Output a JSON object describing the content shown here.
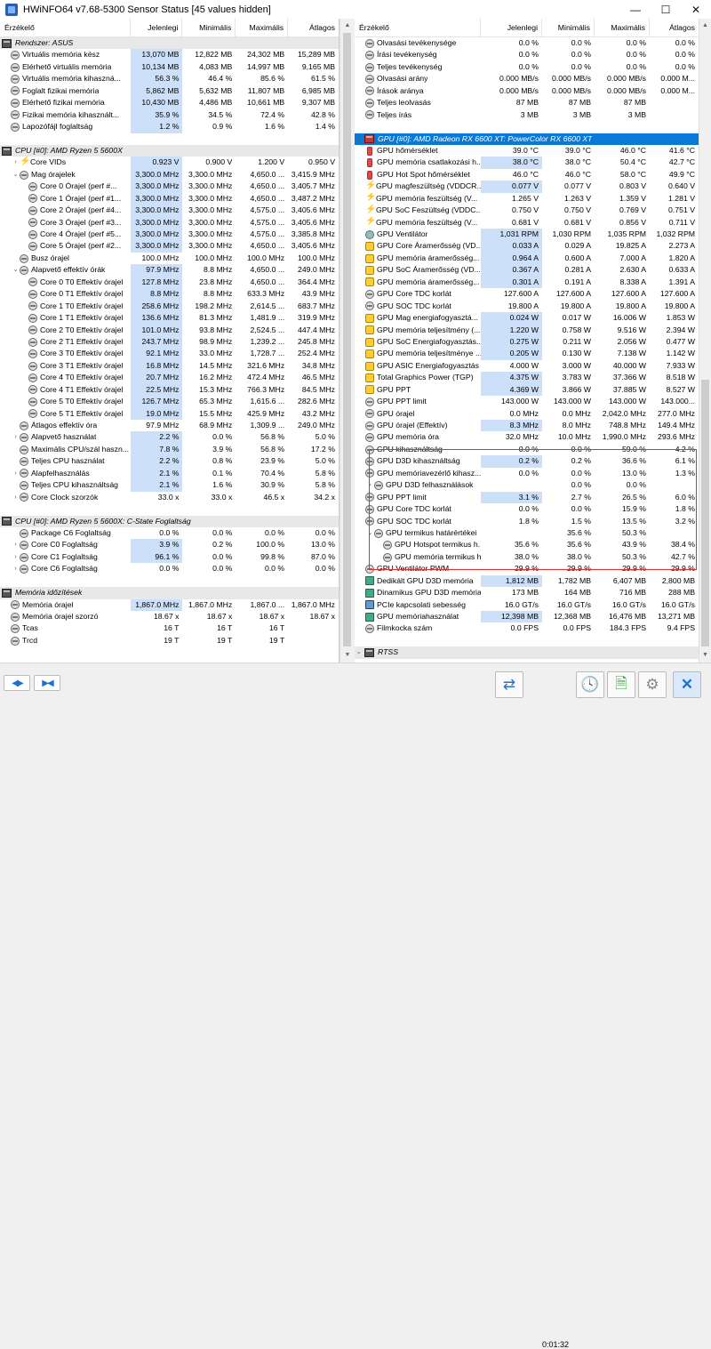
{
  "window": {
    "title": "HWiNFO64 v7.68-5300 Sensor Status [45 values hidden]",
    "minimize": "—",
    "maximize": "☐",
    "close": "✕"
  },
  "columns": {
    "name": "Érzékelő",
    "current": "Jelenlegi",
    "min": "Minimális",
    "max": "Maximális",
    "avg": "Átlagos"
  },
  "left_rows": [
    {
      "t": "group",
      "icon": "pc",
      "name": "Rendszer: ASUS"
    },
    {
      "icon": "gauge",
      "name": "Virtuális memória kész",
      "cur": "13,070 MB",
      "min": "12,822 MB",
      "max": "24,302 MB",
      "avg": "15,289 MB",
      "hl": true
    },
    {
      "icon": "gauge",
      "name": "Elérhető virtuális memória",
      "cur": "10,134 MB",
      "min": "4,083 MB",
      "max": "14,997 MB",
      "avg": "9,165 MB",
      "hl": true
    },
    {
      "icon": "gauge",
      "name": "Virtuális memória kihaszná...",
      "cur": "56.3 %",
      "min": "46.4 %",
      "max": "85.6 %",
      "avg": "61.5 %",
      "hl": true
    },
    {
      "icon": "gauge",
      "name": "Foglalt fizikai memória",
      "cur": "5,862 MB",
      "min": "5,632 MB",
      "max": "11,807 MB",
      "avg": "6,985 MB",
      "hl": true
    },
    {
      "icon": "gauge",
      "name": "Elérhető fizikai memória",
      "cur": "10,430 MB",
      "min": "4,486 MB",
      "max": "10,661 MB",
      "avg": "9,307 MB",
      "hl": true
    },
    {
      "icon": "gauge",
      "name": "Fizikai memória kihasznált...",
      "cur": "35.9 %",
      "min": "34.5 %",
      "max": "72.4 %",
      "avg": "42.8 %",
      "hl": true
    },
    {
      "icon": "gauge",
      "name": "Lapozófájl foglaltság",
      "cur": "1.2 %",
      "min": "0.9 %",
      "max": "1.6 %",
      "avg": "1.4 %",
      "hl": true
    },
    {
      "t": "blank"
    },
    {
      "t": "group",
      "icon": "chip",
      "name": "CPU [#0]: AMD Ryzen 5 5600X"
    },
    {
      "tg": ">",
      "icon": "volt",
      "ind": 1,
      "name": "Core VIDs",
      "cur": "0.923 V",
      "min": "0.900 V",
      "max": "1.200 V",
      "avg": "0.950 V",
      "hl": true
    },
    {
      "tg": "v",
      "icon": "gauge",
      "ind": 1,
      "name": "Mag órajelek",
      "cur": "3,300.0 MHz",
      "min": "3,300.0 MHz",
      "max": "4,650.0 ...",
      "avg": "3,415.9 MHz",
      "hl": true
    },
    {
      "icon": "gauge",
      "ind": 2,
      "name": "Core 0 Órajel (perf #...",
      "cur": "3,300.0 MHz",
      "min": "3,300.0 MHz",
      "max": "4,650.0 ...",
      "avg": "3,405.7 MHz",
      "hl": true
    },
    {
      "icon": "gauge",
      "ind": 2,
      "name": "Core 1 Órajel (perf #1...",
      "cur": "3,300.0 MHz",
      "min": "3,300.0 MHz",
      "max": "4,650.0 ...",
      "avg": "3,487.2 MHz",
      "hl": true
    },
    {
      "icon": "gauge",
      "ind": 2,
      "name": "Core 2 Órajel (perf #4...",
      "cur": "3,300.0 MHz",
      "min": "3,300.0 MHz",
      "max": "4,575.0 ...",
      "avg": "3,405.6 MHz",
      "hl": true
    },
    {
      "icon": "gauge",
      "ind": 2,
      "name": "Core 3 Órajel (perf #3...",
      "cur": "3,300.0 MHz",
      "min": "3,300.0 MHz",
      "max": "4,575.0 ...",
      "avg": "3,405.6 MHz",
      "hl": true
    },
    {
      "icon": "gauge",
      "ind": 2,
      "name": "Core 4 Órajel (perf #5...",
      "cur": "3,300.0 MHz",
      "min": "3,300.0 MHz",
      "max": "4,575.0 ...",
      "avg": "3,385.8 MHz",
      "hl": true
    },
    {
      "icon": "gauge",
      "ind": 2,
      "name": "Core 5 Órajel (perf #2...",
      "cur": "3,300.0 MHz",
      "min": "3,300.0 MHz",
      "max": "4,650.0 ...",
      "avg": "3,405.6 MHz",
      "hl": true
    },
    {
      "icon": "gauge",
      "ind": 1,
      "name": "Busz órajel",
      "cur": "100.0 MHz",
      "min": "100.0 MHz",
      "max": "100.0 MHz",
      "avg": "100.0 MHz",
      "hl": false
    },
    {
      "tg": "v",
      "icon": "gauge",
      "ind": 1,
      "name": "Alapvető effektív órák",
      "cur": "97.9 MHz",
      "min": "8.8 MHz",
      "max": "4,650.0 ...",
      "avg": "249.0 MHz",
      "hl": true
    },
    {
      "icon": "gauge",
      "ind": 2,
      "name": "Core 0 T0 Effektív órajel",
      "cur": "127.8 MHz",
      "min": "23.8 MHz",
      "max": "4,650.0 ...",
      "avg": "364.4 MHz",
      "hl": true
    },
    {
      "icon": "gauge",
      "ind": 2,
      "name": "Core 0 T1 Effektív órajel",
      "cur": "8.8 MHz",
      "min": "8.8 MHz",
      "max": "633.3 MHz",
      "avg": "43.9 MHz",
      "hl": true
    },
    {
      "icon": "gauge",
      "ind": 2,
      "name": "Core 1 T0 Effektív órajel",
      "cur": "258.6 MHz",
      "min": "198.2 MHz",
      "max": "2,614.5 ...",
      "avg": "683.7 MHz",
      "hl": true
    },
    {
      "icon": "gauge",
      "ind": 2,
      "name": "Core 1 T1 Effektív órajel",
      "cur": "136.6 MHz",
      "min": "81.3 MHz",
      "max": "1,481.9 ...",
      "avg": "319.9 MHz",
      "hl": true
    },
    {
      "icon": "gauge",
      "ind": 2,
      "name": "Core 2 T0 Effektív órajel",
      "cur": "101.0 MHz",
      "min": "93.8 MHz",
      "max": "2,524.5 ...",
      "avg": "447.4 MHz",
      "hl": true
    },
    {
      "icon": "gauge",
      "ind": 2,
      "name": "Core 2 T1 Effektív órajel",
      "cur": "243.7 MHz",
      "min": "98.9 MHz",
      "max": "1,239.2 ...",
      "avg": "245.8 MHz",
      "hl": true
    },
    {
      "icon": "gauge",
      "ind": 2,
      "name": "Core 3 T0 Effektív órajel",
      "cur": "92.1 MHz",
      "min": "33.0 MHz",
      "max": "1,728.7 ...",
      "avg": "252.4 MHz",
      "hl": true
    },
    {
      "icon": "gauge",
      "ind": 2,
      "name": "Core 3 T1 Effektív órajel",
      "cur": "16.8 MHz",
      "min": "14.5 MHz",
      "max": "321.6 MHz",
      "avg": "34.8 MHz",
      "hl": true
    },
    {
      "icon": "gauge",
      "ind": 2,
      "name": "Core 4 T0 Effektív órajel",
      "cur": "20.7 MHz",
      "min": "16.2 MHz",
      "max": "472.4 MHz",
      "avg": "46.5 MHz",
      "hl": true
    },
    {
      "icon": "gauge",
      "ind": 2,
      "name": "Core 4 T1 Effektív órajel",
      "cur": "22.5 MHz",
      "min": "15.3 MHz",
      "max": "766.3 MHz",
      "avg": "84.5 MHz",
      "hl": true
    },
    {
      "icon": "gauge",
      "ind": 2,
      "name": "Core 5 T0 Effektív órajel",
      "cur": "126.7 MHz",
      "min": "65.3 MHz",
      "max": "1,615.6 ...",
      "avg": "282.6 MHz",
      "hl": true
    },
    {
      "icon": "gauge",
      "ind": 2,
      "name": "Core 5 T1 Effektív órajel",
      "cur": "19.0 MHz",
      "min": "15.5 MHz",
      "max": "425.9 MHz",
      "avg": "43.2 MHz",
      "hl": true
    },
    {
      "icon": "gauge",
      "ind": 1,
      "name": "Átlagos effektív óra",
      "cur": "97.9 MHz",
      "min": "68.9 MHz",
      "max": "1,309.9 ...",
      "avg": "249.0 MHz",
      "hl": false
    },
    {
      "tg": ">",
      "icon": "gauge",
      "ind": 1,
      "name": "Alapvető használat",
      "cur": "2.2 %",
      "min": "0.0 %",
      "max": "56.8 %",
      "avg": "5.0 %",
      "hl": true
    },
    {
      "icon": "gauge",
      "ind": 1,
      "name": "Maximális CPU/szál haszn...",
      "cur": "7.8 %",
      "min": "3.9 %",
      "max": "56.8 %",
      "avg": "17.2 %",
      "hl": true
    },
    {
      "icon": "gauge",
      "ind": 1,
      "name": "Teljes CPU használat",
      "cur": "2.2 %",
      "min": "0.8 %",
      "max": "23.9 %",
      "avg": "5.0 %",
      "hl": true
    },
    {
      "tg": ">",
      "icon": "gauge",
      "ind": 1,
      "name": "Alapfelhasználás",
      "cur": "2.1 %",
      "min": "0.1 %",
      "max": "70.4 %",
      "avg": "5.8 %",
      "hl": true
    },
    {
      "icon": "gauge",
      "ind": 1,
      "name": "Teljes CPU kihasználtság",
      "cur": "2.1 %",
      "min": "1.6 %",
      "max": "30.9 %",
      "avg": "5.8 %",
      "hl": true
    },
    {
      "tg": ">",
      "icon": "gauge",
      "ind": 1,
      "name": "Core Clock szorzók",
      "cur": "33.0 x",
      "min": "33.0 x",
      "max": "46.5 x",
      "avg": "34.2 x",
      "hl": false
    },
    {
      "t": "blank"
    },
    {
      "t": "group",
      "icon": "chip",
      "name": "CPU [#0]: AMD Ryzen 5 5600X: C-State Foglaltság"
    },
    {
      "icon": "gauge",
      "ind": 1,
      "name": "Package C6 Foglaltság",
      "cur": "0.0 %",
      "min": "0.0 %",
      "max": "0.0 %",
      "avg": "0.0 %",
      "hl": false
    },
    {
      "tg": ">",
      "icon": "gauge",
      "ind": 1,
      "name": "Core C0 Foglaltság",
      "cur": "3.9 %",
      "min": "0.2 %",
      "max": "100.0 %",
      "avg": "13.0 %",
      "hl": true
    },
    {
      "tg": ">",
      "icon": "gauge",
      "ind": 1,
      "name": "Core C1 Foglaltság",
      "cur": "96.1 %",
      "min": "0.0 %",
      "max": "99.8 %",
      "avg": "87.0 %",
      "hl": true
    },
    {
      "tg": ">",
      "icon": "gauge",
      "ind": 1,
      "name": "Core C6 Foglaltság",
      "cur": "0.0 %",
      "min": "0.0 %",
      "max": "0.0 %",
      "avg": "0.0 %",
      "hl": false
    },
    {
      "t": "blank"
    },
    {
      "t": "group",
      "icon": "mem",
      "name": "Memória időzítések"
    },
    {
      "icon": "gauge",
      "name": "Memória órajel",
      "cur": "1,867.0 MHz",
      "min": "1,867.0 MHz",
      "max": "1,867.0 ...",
      "avg": "1,867.0 MHz",
      "hl": true
    },
    {
      "icon": "gauge",
      "name": "Memória órajel szorzó",
      "cur": "18.67 x",
      "min": "18.67 x",
      "max": "18.67 x",
      "avg": "18.67 x",
      "hl": false
    },
    {
      "icon": "gauge",
      "name": "Tcas",
      "cur": "16 T",
      "min": "16 T",
      "max": "16 T",
      "avg": "",
      "hl": false
    },
    {
      "icon": "gauge",
      "name": "Trcd",
      "cur": "19 T",
      "min": "19 T",
      "max": "19 T",
      "avg": "",
      "hl": false
    }
  ],
  "right_rows": [
    {
      "icon": "gauge",
      "name": "Olvasási tevékenysége",
      "cur": "0.0 %",
      "min": "0.0 %",
      "max": "0.0 %",
      "avg": "0.0 %"
    },
    {
      "icon": "gauge",
      "name": "Írási tevékenység",
      "cur": "0.0 %",
      "min": "0.0 %",
      "max": "0.0 %",
      "avg": "0.0 %"
    },
    {
      "icon": "gauge",
      "name": "Teljes tevékenység",
      "cur": "0.0 %",
      "min": "0.0 %",
      "max": "0.0 %",
      "avg": "0.0 %"
    },
    {
      "icon": "gauge",
      "name": "Olvasási arány",
      "cur": "0.000 MB/s",
      "min": "0.000 MB/s",
      "max": "0.000 MB/s",
      "avg": "0.000 M..."
    },
    {
      "icon": "gauge",
      "name": "Írások aránya",
      "cur": "0.000 MB/s",
      "min": "0.000 MB/s",
      "max": "0.000 MB/s",
      "avg": "0.000 M..."
    },
    {
      "icon": "gauge",
      "name": "Teljes leolvasás",
      "cur": "87 MB",
      "min": "87 MB",
      "max": "87 MB",
      "avg": ""
    },
    {
      "icon": "gauge",
      "name": "Teljes írás",
      "cur": "3 MB",
      "min": "3 MB",
      "max": "3 MB",
      "avg": ""
    },
    {
      "t": "blank"
    },
    {
      "t": "group",
      "sel": true,
      "tg": "v",
      "icon": "gpu",
      "name": "GPU [#0]: AMD Radeon RX 6600 XT: PowerColor RX 6600 XT"
    },
    {
      "icon": "temp",
      "name": "GPU hőmérséklet",
      "cur": "39.0 °C",
      "min": "39.0 °C",
      "max": "46.0 °C",
      "avg": "41.6 °C"
    },
    {
      "icon": "temp",
      "name": "GPU memória csatlakozási h...",
      "cur": "38.0 °C",
      "min": "38.0 °C",
      "max": "50.4 °C",
      "avg": "42.7 °C",
      "hl": true
    },
    {
      "icon": "temp",
      "name": "GPU Hot Spot hőmérséklet",
      "cur": "46.0 °C",
      "min": "46.0 °C",
      "max": "58.0 °C",
      "avg": "49.9 °C"
    },
    {
      "icon": "volt",
      "name": "GPU magfeszültség (VDDCR...",
      "cur": "0.077 V",
      "min": "0.077 V",
      "max": "0.803 V",
      "avg": "0.640 V",
      "hl": true
    },
    {
      "icon": "volt",
      "name": "GPU memória feszültség (V...",
      "cur": "1.265 V",
      "min": "1.263 V",
      "max": "1.359 V",
      "avg": "1.281 V"
    },
    {
      "icon": "volt",
      "name": "GPU SoC Feszültség (VDDC...",
      "cur": "0.750 V",
      "min": "0.750 V",
      "max": "0.769 V",
      "avg": "0.751 V"
    },
    {
      "icon": "volt",
      "name": "GPU memória feszültség (V...",
      "cur": "0.681 V",
      "min": "0.681 V",
      "max": "0.856 V",
      "avg": "0.711 V"
    },
    {
      "icon": "fan",
      "name": "GPU Ventilátor",
      "cur": "1,031 RPM",
      "min": "1,030 RPM",
      "max": "1,035 RPM",
      "avg": "1,032 RPM",
      "hl": true
    },
    {
      "icon": "pow",
      "name": "GPU Core Áramerősség (VD...",
      "cur": "0.033 A",
      "min": "0.029 A",
      "max": "19.825 A",
      "avg": "2.273 A",
      "hl": true
    },
    {
      "icon": "pow",
      "name": "GPU memória áramerősség...",
      "cur": "0.964 A",
      "min": "0.600 A",
      "max": "7.000 A",
      "avg": "1.820 A",
      "hl": true
    },
    {
      "icon": "pow",
      "name": "GPU SoC Áramerősség (VD...",
      "cur": "0.367 A",
      "min": "0.281 A",
      "max": "2.630 A",
      "avg": "0.633 A",
      "hl": true
    },
    {
      "icon": "pow",
      "name": "GPU memória áramerősség...",
      "cur": "0.301 A",
      "min": "0.191 A",
      "max": "8.338 A",
      "avg": "1.391 A",
      "hl": true
    },
    {
      "icon": "gauge",
      "name": "GPU Core TDC korlát",
      "cur": "127.600 A",
      "min": "127.600 A",
      "max": "127.600 A",
      "avg": "127.600 A"
    },
    {
      "icon": "gauge",
      "name": "GPU SOC TDC korlát",
      "cur": "19.800 A",
      "min": "19.800 A",
      "max": "19.800 A",
      "avg": "19.800 A"
    },
    {
      "icon": "pow",
      "name": "GPU Mag energiafogyasztá...",
      "cur": "0.024 W",
      "min": "0.017 W",
      "max": "16.006 W",
      "avg": "1.853 W",
      "hl": true
    },
    {
      "icon": "pow",
      "name": "GPU memória teljesítmény (...",
      "cur": "1.220 W",
      "min": "0.758 W",
      "max": "9.516 W",
      "avg": "2.394 W",
      "hl": true
    },
    {
      "icon": "pow",
      "name": "GPU SoC Energiafogyasztás...",
      "cur": "0.275 W",
      "min": "0.211 W",
      "max": "2.056 W",
      "avg": "0.477 W",
      "hl": true
    },
    {
      "icon": "pow",
      "name": "GPU memória teljesítménye ...",
      "cur": "0.205 W",
      "min": "0.130 W",
      "max": "7.138 W",
      "avg": "1.142 W",
      "hl": true
    },
    {
      "icon": "pow",
      "name": "GPU ASIC Energiafogyasztás",
      "cur": "4.000 W",
      "min": "3.000 W",
      "max": "40.000 W",
      "avg": "7.933 W"
    },
    {
      "icon": "pow",
      "name": "Total Graphics Power (TGP)",
      "cur": "4.375 W",
      "min": "3.783 W",
      "max": "37.366 W",
      "avg": "8.518 W",
      "hl": true
    },
    {
      "icon": "pow",
      "name": "GPU PPT",
      "cur": "4.369 W",
      "min": "3.866 W",
      "max": "37.885 W",
      "avg": "8.527 W",
      "hl": true
    },
    {
      "icon": "gauge",
      "name": "GPU PPT limit",
      "cur": "143.000 W",
      "min": "143.000 W",
      "max": "143.000 W",
      "avg": "143.000..."
    },
    {
      "icon": "gauge",
      "name": "GPU órajel",
      "cur": "0.0 MHz",
      "min": "0.0 MHz",
      "max": "2,042.0 MHz",
      "avg": "277.0 MHz"
    },
    {
      "icon": "gauge",
      "name": "GPU órajel (Effektív)",
      "cur": "8.3 MHz",
      "min": "8.0 MHz",
      "max": "748.8 MHz",
      "avg": "149.4 MHz",
      "hl": true
    },
    {
      "icon": "gauge",
      "name": "GPU memória óra",
      "cur": "32.0 MHz",
      "min": "10.0 MHz",
      "max": "1,990.0 MHz",
      "avg": "293.6 MHz"
    },
    {
      "icon": "gauge",
      "name": "GPU kihasználtság",
      "cur": "0.0 %",
      "min": "0.0 %",
      "max": "59.0 %",
      "avg": "4.2 %"
    },
    {
      "icon": "gauge",
      "name": "GPU D3D kihasználtság",
      "cur": "0.2 %",
      "min": "0.2 %",
      "max": "36.6 %",
      "avg": "6.1 %",
      "hl": true
    },
    {
      "icon": "gauge",
      "name": "GPU memóriavezérlő kihasz...",
      "cur": "0.0 %",
      "min": "0.0 %",
      "max": "13.0 %",
      "avg": "1.3 %"
    },
    {
      "tg": ">",
      "icon": "gauge",
      "ind": 1,
      "name": "GPU D3D felhasználások",
      "cur": "",
      "min": "0.0 %",
      "max": "0.0 %",
      "avg": ""
    },
    {
      "icon": "gauge",
      "name": "GPU PPT limit",
      "cur": "3.1 %",
      "min": "2.7 %",
      "max": "26.5 %",
      "avg": "6.0 %",
      "hl": true
    },
    {
      "icon": "gauge",
      "name": "GPU Core TDC korlát",
      "cur": "0.0 %",
      "min": "0.0 %",
      "max": "15.9 %",
      "avg": "1.8 %"
    },
    {
      "icon": "gauge",
      "name": "GPU SOC TDC korlát",
      "cur": "1.8 %",
      "min": "1.5 %",
      "max": "13.5 %",
      "avg": "3.2 %"
    },
    {
      "tg": "v",
      "icon": "gauge",
      "ind": 1,
      "name": "GPU termikus határértékei",
      "cur": "",
      "min": "35.6 %",
      "max": "50.3 %",
      "avg": ""
    },
    {
      "icon": "gauge",
      "ind": 2,
      "name": "GPU Hotspot termikus h...",
      "cur": "35.6 %",
      "min": "35.6 %",
      "max": "43.9 %",
      "avg": "38.4 %"
    },
    {
      "icon": "gauge",
      "ind": 2,
      "name": "GPU memória termikus h...",
      "cur": "38.0 %",
      "min": "38.0 %",
      "max": "50.3 %",
      "avg": "42.7 %"
    },
    {
      "icon": "gauge",
      "name": "GPU Ventilátor PWM",
      "cur": "29.9 %",
      "min": "29.9 %",
      "max": "29.9 %",
      "avg": "29.9 %"
    },
    {
      "icon": "mem",
      "name": "Dedikált GPU D3D memória",
      "cur": "1,812 MB",
      "min": "1,782 MB",
      "max": "6,407 MB",
      "avg": "2,800 MB",
      "hl": true
    },
    {
      "icon": "mem",
      "name": "Dinamikus GPU D3D memória",
      "cur": "173 MB",
      "min": "164 MB",
      "max": "716 MB",
      "avg": "288 MB"
    },
    {
      "icon": "bus",
      "name": "PCIe kapcsolati sebesség",
      "cur": "16.0 GT/s",
      "min": "16.0 GT/s",
      "max": "16.0 GT/s",
      "avg": "16.0 GT/s"
    },
    {
      "icon": "mem",
      "name": "GPU memóriahasználat",
      "cur": "12,398 MB",
      "min": "12,368 MB",
      "max": "16,476 MB",
      "avg": "13,271 MB",
      "hl": true
    },
    {
      "icon": "gauge",
      "name": "Filmkocka szám",
      "cur": "0.0 FPS",
      "min": "0.0 FPS",
      "max": "184.3 FPS",
      "avg": "9.4 FPS"
    },
    {
      "t": "blank"
    },
    {
      "t": "group",
      "tg": "v",
      "icon": "pc",
      "name": "RTSS"
    }
  ],
  "bottom": {
    "timer": "0:01:32"
  }
}
